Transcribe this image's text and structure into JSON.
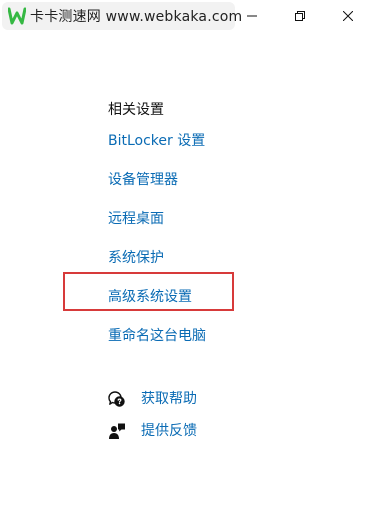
{
  "watermark": {
    "text": "卡卡测速网 www.webkaka.com"
  },
  "window_controls": {
    "minimize": "minimize-icon",
    "restore": "restore-icon",
    "close": "close-icon"
  },
  "related_settings": {
    "title": "相关设置",
    "links": [
      "BitLocker 设置",
      "设备管理器",
      "远程桌面",
      "系统保护",
      "高级系统设置",
      "重命名这台电脑"
    ]
  },
  "help": {
    "get_help": "获取帮助",
    "feedback": "提供反馈"
  },
  "colors": {
    "link": "#0a6bb4",
    "highlight": "#d73a3a",
    "watermark_logo": "#35b843"
  }
}
